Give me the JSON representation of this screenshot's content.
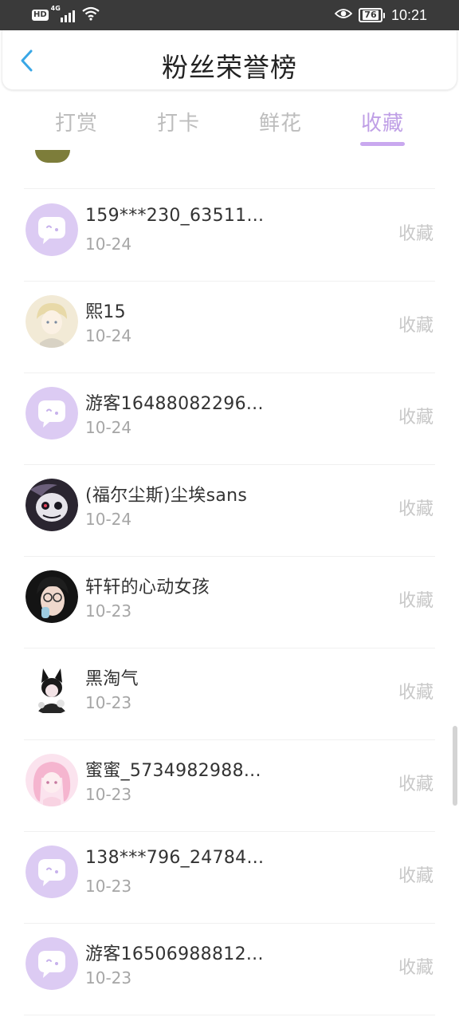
{
  "status_bar": {
    "network": "HD",
    "signal_type": "4G",
    "battery_level": "76",
    "time": "10:21"
  },
  "header": {
    "title": "粉丝荣誉榜"
  },
  "tabs": [
    {
      "label": "打赏",
      "active": false
    },
    {
      "label": "打卡",
      "active": false
    },
    {
      "label": "鲜花",
      "active": false
    },
    {
      "label": "收藏",
      "active": true
    }
  ],
  "colors": {
    "accent": "#c9a8ef",
    "default_avatar_bg": "#dccbf3",
    "muted_text": "#a6a6a6"
  },
  "fans": [
    {
      "name": "159***230_63511...",
      "date": "10-24",
      "action": "收藏",
      "avatar": "default-chat-avatar"
    },
    {
      "name": "熙15",
      "date": "10-24",
      "action": "收藏",
      "avatar": "anime-boy-avatar"
    },
    {
      "name": "游客16488082296...",
      "date": "10-24",
      "action": "收藏",
      "avatar": "default-chat-avatar"
    },
    {
      "name": "(福尔尘斯)尘埃sans",
      "date": "10-24",
      "action": "收藏",
      "avatar": "skull-character-avatar"
    },
    {
      "name": "轩轩的心动女孩",
      "date": "10-23",
      "action": "收藏",
      "avatar": "glasses-girl-avatar"
    },
    {
      "name": "黑淘气",
      "date": "10-23",
      "action": "收藏",
      "avatar": "cat-ear-character-avatar"
    },
    {
      "name": "蜜蜜_5734982988...",
      "date": "10-23",
      "action": "收藏",
      "avatar": "pink-anime-girl-avatar"
    },
    {
      "name": "138***796_24784...",
      "date": "10-23",
      "action": "收藏",
      "avatar": "default-chat-avatar"
    },
    {
      "name": "游客16506988812...",
      "date": "10-23",
      "action": "收藏",
      "avatar": "default-chat-avatar"
    }
  ]
}
